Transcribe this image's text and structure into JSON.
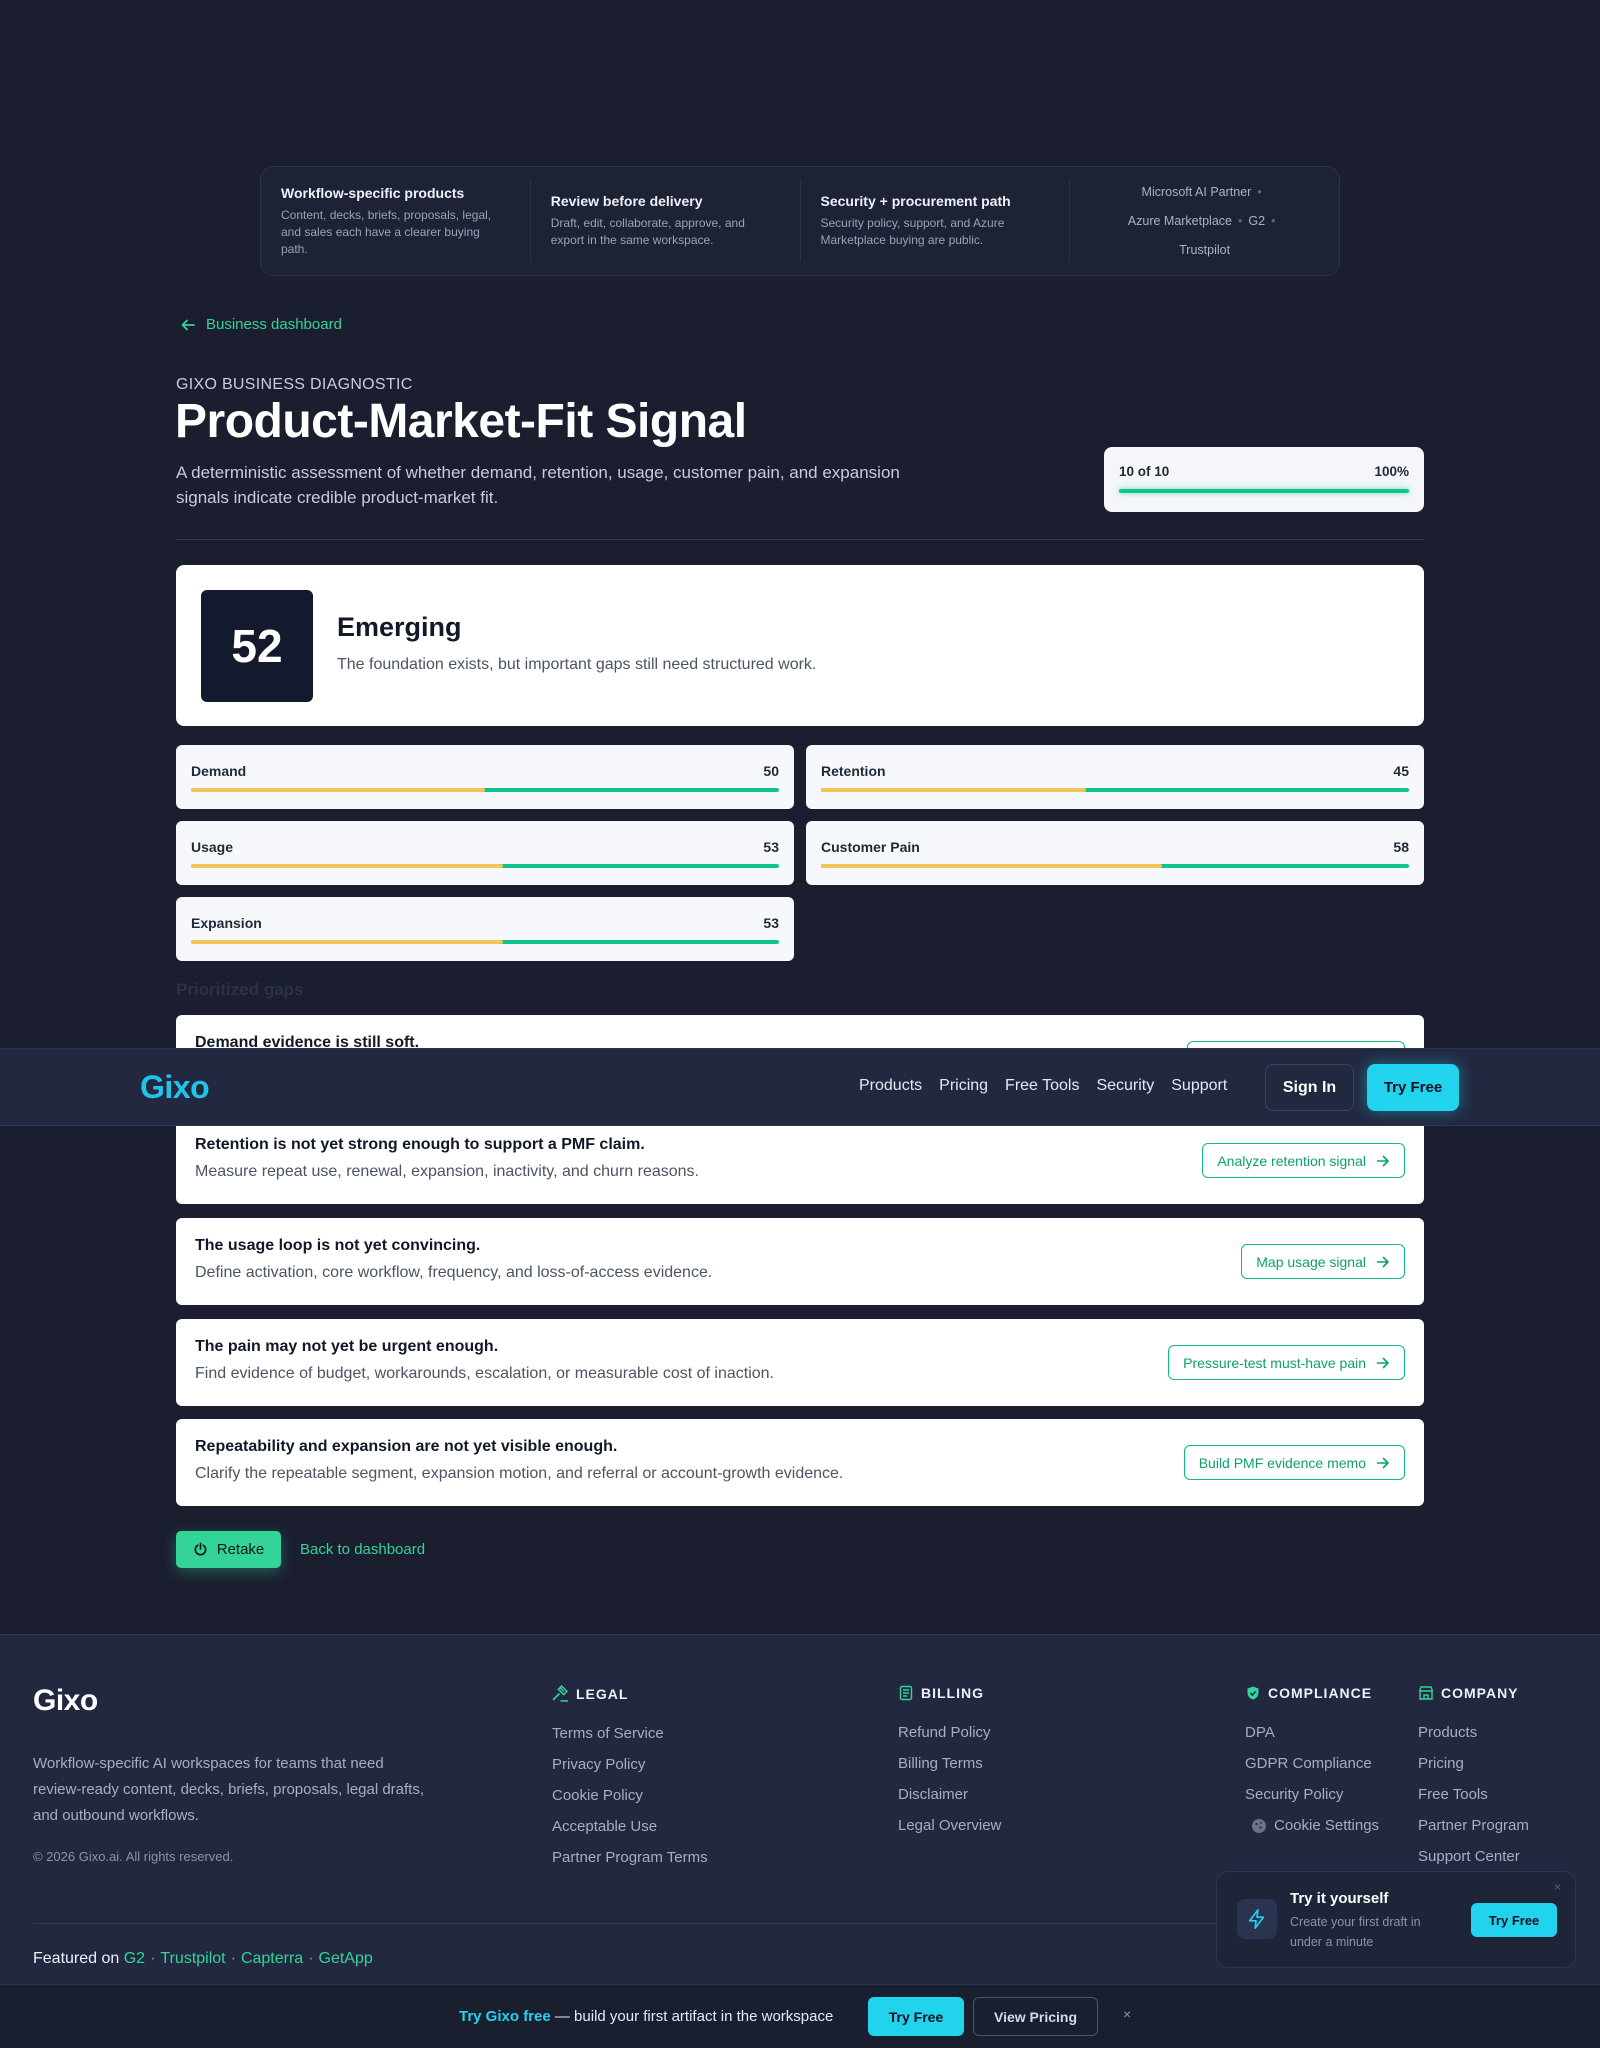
{
  "trust_strip": {
    "items": [
      {
        "title": "Workflow-specific products",
        "text": "Content, decks, briefs, proposals, legal, and sales each have a clearer buying path."
      },
      {
        "title": "Review before delivery",
        "text": "Draft, edit, collaborate, approve, and export in the same workspace."
      },
      {
        "title": "Security + procurement path",
        "text": "Security policy, support, and Azure Marketplace buying are public."
      }
    ],
    "partners": [
      "Microsoft AI Partner",
      "Azure Marketplace",
      "G2",
      "Trustpilot"
    ]
  },
  "back_link": "Business dashboard",
  "header": {
    "eyebrow": "GIXO BUSINESS DIAGNOSTIC",
    "title": "Product-Market-Fit Signal",
    "subtitle": "A deterministic assessment of whether demand, retention, usage, customer pain, and expansion signals indicate credible product-market fit."
  },
  "progress": {
    "label": "10 of 10",
    "percent_label": "100%",
    "value": 1.0
  },
  "score": {
    "value": "52",
    "label": "Emerging",
    "description": "The foundation exists, but important gaps still need structured work."
  },
  "metrics": [
    {
      "name": "Demand",
      "score": "50",
      "value": 50
    },
    {
      "name": "Retention",
      "score": "45",
      "value": 45
    },
    {
      "name": "Usage",
      "score": "53",
      "value": 53
    },
    {
      "name": "Customer Pain",
      "score": "58",
      "value": 58
    },
    {
      "name": "Expansion",
      "score": "53",
      "value": 53
    }
  ],
  "section_title": "Prioritized gaps",
  "gaps": [
    {
      "title": "Demand evidence is still soft.",
      "text": "",
      "action": ""
    },
    {
      "title": "Retention is not yet strong enough to support a PMF claim.",
      "text": "Measure repeat use, renewal, expansion, inactivity, and churn reasons.",
      "action": "Analyze retention signal"
    },
    {
      "title": "The usage loop is not yet convincing.",
      "text": "Define activation, core workflow, frequency, and loss-of-access evidence.",
      "action": "Map usage signal"
    },
    {
      "title": "The pain may not yet be urgent enough.",
      "text": "Find evidence of budget, workarounds, escalation, or measurable cost of inaction.",
      "action": "Pressure-test must-have pain"
    },
    {
      "title": "Repeatability and expansion are not yet visible enough.",
      "text": "Clarify the repeatable segment, expansion motion, and referral or account-growth evidence.",
      "action": "Build PMF evidence memo"
    }
  ],
  "nav": {
    "brand": "Gixo",
    "links": [
      "Products",
      "Pricing",
      "Free Tools",
      "Security",
      "Support"
    ],
    "sign_in": "Sign In",
    "try_free": "Try Free"
  },
  "actions": {
    "retake": "Retake",
    "back": "Back to dashboard"
  },
  "footer": {
    "brand": "Gixo",
    "description": "Workflow-specific AI workspaces for teams that need review-ready content, decks, briefs, proposals, legal drafts, and outbound workflows.",
    "copyright": "© 2026 Gixo.ai. All rights reserved.",
    "columns": [
      {
        "heading": "LEGAL",
        "icon": "gavel-icon",
        "links": [
          "Terms of Service",
          "Privacy Policy",
          "Cookie Policy",
          "Acceptable Use",
          "Partner Program Terms"
        ]
      },
      {
        "heading": "BILLING",
        "icon": "receipt-icon",
        "links": [
          "Refund Policy",
          "Billing Terms",
          "Disclaimer",
          "Legal Overview"
        ]
      },
      {
        "heading": "COMPLIANCE",
        "icon": "shield-icon",
        "links": [
          "DPA",
          "GDPR Compliance",
          "Security Policy",
          "Cookie Settings"
        ]
      },
      {
        "heading": "COMPANY",
        "icon": "store-icon",
        "links": [
          "Products",
          "Pricing",
          "Free Tools",
          "Partner Program",
          "Support Center"
        ]
      }
    ],
    "featured_label": "Featured on",
    "featured_links": [
      "G2",
      "Trustpilot",
      "Capterra",
      "GetApp"
    ]
  },
  "popup": {
    "title": "Try it yourself",
    "text": "Create your first draft in under a minute",
    "button": "Try Free",
    "close": "×"
  },
  "bottom_bar": {
    "strong": "Try Gixo free",
    "text": " — build your first artifact in the workspace",
    "try": "Try Free",
    "pricing": "View Pricing",
    "close": "×"
  },
  "colors": {
    "accent_green": "#34d399",
    "accent_cyan": "#22d3ee",
    "bar_yellow": "#f4c35a",
    "bar_green": "#10c58c",
    "background": "#1a1e2f"
  }
}
